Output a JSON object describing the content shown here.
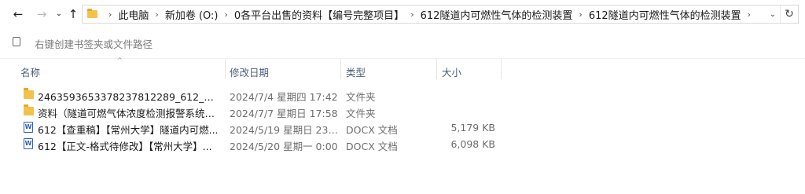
{
  "nav": {
    "back_icon": "arrow-left-icon",
    "forward_icon": "arrow-right-icon",
    "recent_icon": "chevron-down-icon",
    "up_icon": "arrow-up-icon"
  },
  "breadcrumbs": [
    "此电脑",
    "新加卷 (O:)",
    "0各平台出售的资料【编号完整项目】",
    "612隧道内可燃性气体的检测装置",
    "612隧道内可燃性气体的检测装置"
  ],
  "favorites_hint": "右键创建书签夹或文件路径",
  "columns": {
    "name": "名称",
    "date": "修改日期",
    "type": "类型",
    "size": "大小"
  },
  "files": [
    {
      "icon": "folder-icon",
      "name": "246359365337823781228​9_612_612【...",
      "date": "2024/7/4 星期四 17:42",
      "type": "文件夹",
      "size": ""
    },
    {
      "icon": "folder-icon",
      "name": "资料（隧道可燃气体浓度检测报警系统设...",
      "date": "2024/7/7 星期日 17:58",
      "type": "文件夹",
      "size": ""
    },
    {
      "icon": "docx-icon",
      "name": "612【查重稿】【常州大学】隧道内可燃...",
      "date": "2024/5/19 星期日 23:...",
      "type": "DOCX 文档",
      "size": "5,179 KB"
    },
    {
      "icon": "docx-icon",
      "name": "612【正文-格式待修改】【常州大学】...",
      "date": "2024/5/20 星期一 0:00",
      "type": "DOCX 文档",
      "size": "6,098 KB"
    }
  ],
  "colors": {
    "folder": "#f3c24a",
    "header_text": "#4c607a",
    "word_blue": "#2e5fb5"
  }
}
